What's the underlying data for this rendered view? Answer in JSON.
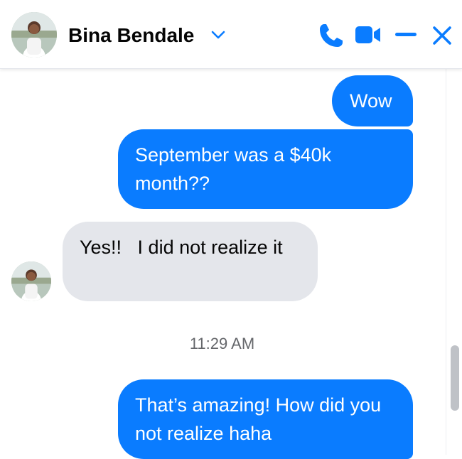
{
  "header": {
    "contact_name": "Bina Bendale",
    "icons": [
      "avatar",
      "chevron-down-icon",
      "phone-icon",
      "video-camera-icon",
      "minimize-icon",
      "close-icon"
    ],
    "accent_color": "#0a7cff"
  },
  "messages": [
    {
      "direction": "outgoing",
      "text": "Wow"
    },
    {
      "direction": "outgoing",
      "text": "September was a $40k month??"
    },
    {
      "direction": "incoming",
      "text": "Yes!!   I did not realize it"
    },
    {
      "direction": "outgoing",
      "text": "That’s amazing! How did you not realize haha"
    }
  ],
  "timestamp": "11:29 AM",
  "colors": {
    "outgoing_bubble": "#0a7cff",
    "incoming_bubble": "#e4e6eb",
    "timestamp": "#65676b"
  }
}
